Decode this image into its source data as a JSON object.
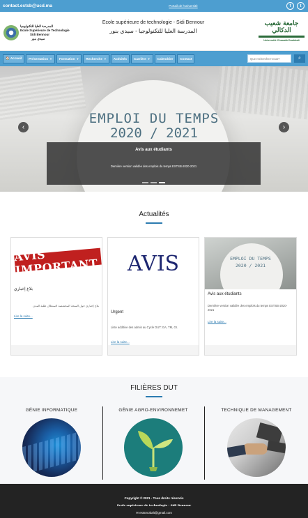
{
  "topbar": {
    "email": "contact.estsb@ucd.ma",
    "portal_link": "Portail de l'université",
    "social": [
      {
        "name": "facebook-icon",
        "glyph": "f"
      },
      {
        "name": "twitter-icon",
        "glyph": "t"
      }
    ]
  },
  "header": {
    "left_logo": {
      "line1": "المدرسة العليا للتكنولوجيا",
      "line2": "Ecole Supérieure de Technologie",
      "line3": "Sidi Bennour",
      "line4": "سيدي بنور"
    },
    "title_fr": "Ecole supérieure de technologie - Sidi Bennour",
    "title_ar": "المدرسة العليا للتكنولوجيا - سيدي بنور",
    "right_logo": {
      "arabic": "جامعة شعيب الدكالي",
      "english": "Université Chouaib Doukkali"
    }
  },
  "nav": {
    "items": [
      {
        "label": "🏠 Accueil",
        "dropdown": false
      },
      {
        "label": "Présentation",
        "dropdown": true
      },
      {
        "label": "Formation",
        "dropdown": true
      },
      {
        "label": "Recherche",
        "dropdown": true
      },
      {
        "label": "Activités",
        "dropdown": false
      },
      {
        "label": "Carrière",
        "dropdown": true
      },
      {
        "label": "Calendrier",
        "dropdown": false
      },
      {
        "label": "Contact",
        "dropdown": false
      }
    ],
    "search_placeholder": "Que recherchez-vous?"
  },
  "hero": {
    "title_line1": "EMPLOI DU TEMPS",
    "title_line2": "2020 / 2021",
    "caption_title": "Avis aux étudiants",
    "caption_text": "Dernière version validée des emplois du temps ESTSB-2020-2021",
    "slide_count": 3,
    "active_slide": 2
  },
  "actualites": {
    "heading": "Actualités",
    "cards": [
      {
        "image_text": "AVIS IMPORTANT",
        "title": "بلاغ إخباري",
        "description": "بلاغ إخباري حول المنحة المخصصة لاستغلال طلبة المدن",
        "link": "Lire la suite..."
      },
      {
        "image_text": "AVIS",
        "title": "Urgent",
        "description": "Liste additive des admis au Cycle DUT: GA, TM, GI.",
        "link": "Lire la suite..."
      },
      {
        "image_text_1": "EMPLOI DU TEMPS",
        "image_text_2": "2020 / 2021",
        "title": "Avis aux étudiants",
        "description": "Dernière version validée des emplois du temps ESTSB-2020-2021",
        "link": "Lire la suite..."
      }
    ]
  },
  "filieres": {
    "heading": "FILIÈRES DUT",
    "items": [
      {
        "name": "GÉNIE INFORMATIQUE"
      },
      {
        "name": "GÉNIE AGRO-ENVIRONNEMET"
      },
      {
        "name": "TECHNIQUE DE MANAGEMENT"
      }
    ]
  },
  "footer": {
    "copyright": "Copyright © 2021 - Tous droits réservés",
    "school": "Ecole supérieure de technologie - Sidi Bennour",
    "email": "✉ estsmobalt@gmail.com"
  }
}
